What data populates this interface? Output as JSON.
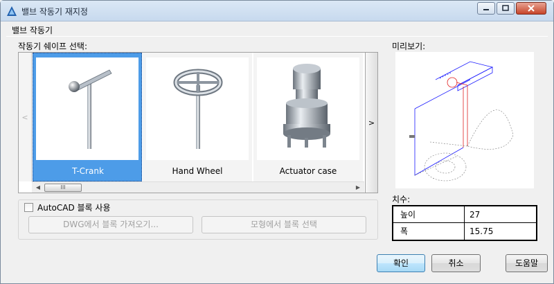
{
  "window": {
    "title": "밸브 작동기 재지정",
    "controls": {
      "minimize": "minimize",
      "maximize": "maximize",
      "close": "close"
    }
  },
  "section": {
    "title": "밸브 작동기"
  },
  "shape_select": {
    "label": "작동기 쉐이프 선택:",
    "items": [
      {
        "label": "T-Crank",
        "selected": true,
        "icon": "t-crank-icon"
      },
      {
        "label": "Hand Wheel",
        "selected": false,
        "icon": "hand-wheel-icon"
      },
      {
        "label": "Actuator case",
        "selected": false,
        "icon": "actuator-case-icon"
      }
    ],
    "nav_prev": "<",
    "nav_next": ">",
    "scroll_left": "◀",
    "scroll_right": "▶",
    "scroll_thumb": "III"
  },
  "autocad_block": {
    "checkbox_label": "AutoCAD 블록 사용",
    "checked": false,
    "import_dwg_button": "DWG에서 블록 가져오기...",
    "select_model_button": "모형에서 블록 선택"
  },
  "preview": {
    "label": "미리보기:"
  },
  "dimensions": {
    "label": "치수:",
    "rows": [
      {
        "key": "높이",
        "value": "27"
      },
      {
        "key": "폭",
        "value": "15.75"
      }
    ]
  },
  "buttons": {
    "ok": "확인",
    "cancel": "취소",
    "help": "도움말"
  },
  "colors": {
    "selection": "#4d9ce8",
    "preview_blue": "#1a1aff",
    "preview_red": "#e02020"
  }
}
